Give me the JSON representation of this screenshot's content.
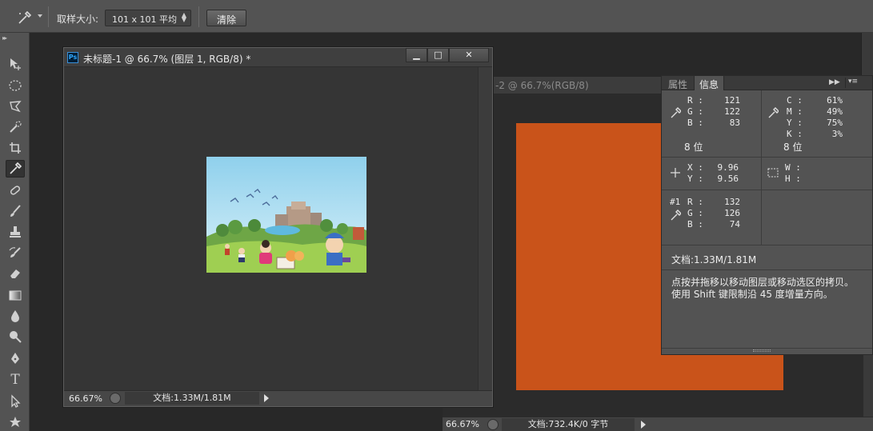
{
  "options_bar": {
    "tool_icon": "eyedropper-icon",
    "sample_size_label": "取样大小:",
    "sample_size_value": "101 x 101 平均",
    "clear_button": "清除"
  },
  "toolbar": {
    "tools": [
      "move-tool-icon",
      "marquee-icon",
      "lasso-icon",
      "quick-selection-icon",
      "crop-icon",
      "eyedropper-icon",
      "healing-brush-icon",
      "brush-icon",
      "clone-stamp-icon",
      "history-brush-icon",
      "eraser-icon",
      "gradient-icon",
      "blur-icon",
      "dodge-icon",
      "pen-icon",
      "type-icon",
      "path-selection-icon",
      "shape-icon"
    ]
  },
  "doc1": {
    "badge": "Ps",
    "title": "未标题-1 @ 66.7% (图层 1, RGB/8) *",
    "minimize": "▁",
    "maximize": "□",
    "close": "✕",
    "zoom": "66.67%",
    "doc_size": "文档:1.33M/1.81M"
  },
  "doc2": {
    "title": "-2 @ 66.7%(RGB/8)",
    "zoom": "66.67%",
    "doc_size": "文档:732.4K/0 字节",
    "fill_color": "#c9531a"
  },
  "info_panel": {
    "tabs": [
      "属性",
      "信息"
    ],
    "active_tab": "信息",
    "rgb": {
      "R": "121",
      "G": "122",
      "B": "83"
    },
    "rgb_bits": "8 位",
    "cmyk": {
      "C": "61%",
      "M": "49%",
      "Y": "75%",
      "K": "3%"
    },
    "cmyk_bits": "8 位",
    "xy": {
      "X": "9.96",
      "Y": "9.56"
    },
    "wh": {
      "W": "",
      "H": ""
    },
    "sample1_label": "#1",
    "sample1": {
      "R": "132",
      "G": "126",
      "B": "74"
    },
    "doc_size": "文档:1.33M/1.81M",
    "hint": "点按并拖移以移动图层或移动选区的拷贝。使用 Shift 键限制沿 45 度增量方向。"
  },
  "colors": {
    "chrome": "#535353",
    "workspace": "#282828",
    "canvas_bg": "#353535",
    "accent_orange": "#c9531a"
  }
}
